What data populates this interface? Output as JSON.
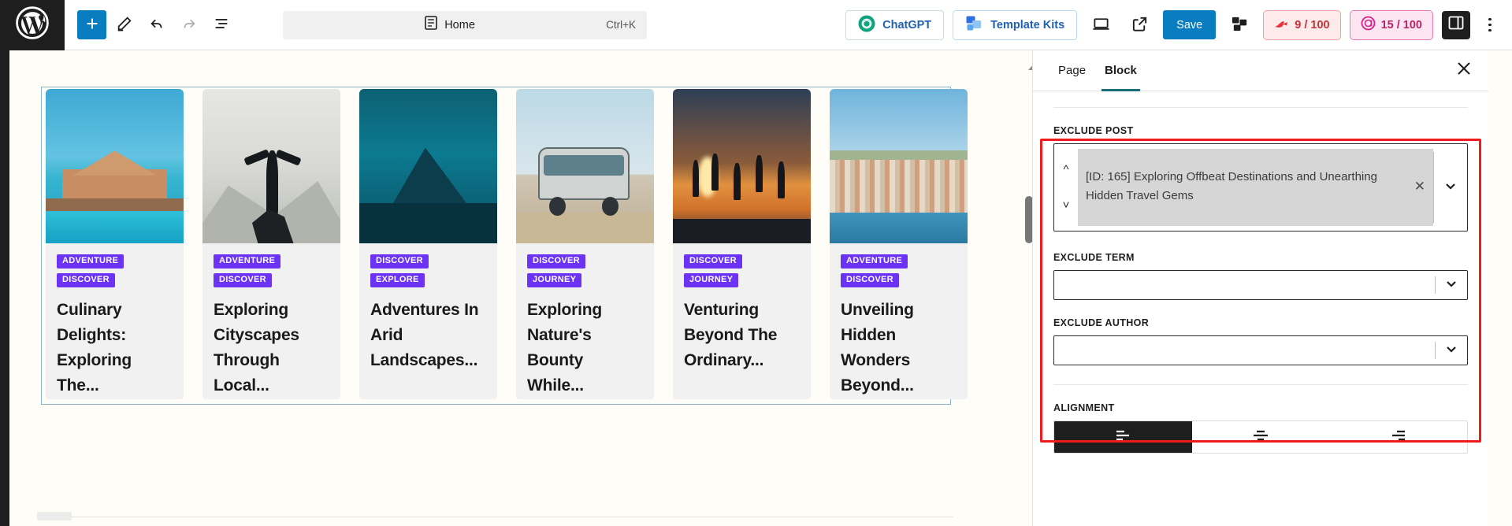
{
  "toolbar": {
    "logo_icon": "wordpress-logo-icon",
    "add_block_label": "+",
    "add_block_icon": "plus-icon",
    "edit_icon": "pencil-icon",
    "undo_icon": "undo-arrow-icon",
    "redo_icon": "redo-arrow-icon",
    "list_view_icon": "document-outline-icon",
    "command_bar": {
      "doc_icon": "page-icon",
      "label": "Home",
      "shortcut": "Ctrl+K"
    },
    "chatgpt_label": "ChatGPT",
    "chatgpt_icon": "chatgpt-logo-icon",
    "template_kits_label": "Template Kits",
    "template_kits_icon": "template-kits-icon",
    "preview_icon": "desktop-preview-icon",
    "view_site_icon": "external-link-icon",
    "save_label": "Save",
    "plugin_icon": "blocks-stack-icon",
    "seo_score": {
      "icon": "rank-math-icon",
      "value": "9 / 100"
    },
    "ai_score": {
      "icon": "ai-target-icon",
      "value": "15 / 100"
    },
    "settings_sidebar_icon": "sidebar-panel-icon",
    "options_icon": "kebab-menu-icon"
  },
  "canvas": {
    "posts": [
      {
        "image": "overwater-bungalow-photo",
        "tags": [
          "ADVENTURE",
          "DISCOVER"
        ],
        "title": "Culinary Delights: Exploring The..."
      },
      {
        "image": "woman-on-mountain-photo",
        "tags": [
          "ADVENTURE",
          "DISCOVER"
        ],
        "title": "Exploring Cityscapes Through Local..."
      },
      {
        "image": "arid-mountain-lake-photo",
        "tags": [
          "DISCOVER",
          "EXPLORE"
        ],
        "title": "Adventures In Arid Landscapes..."
      },
      {
        "image": "vintage-van-beach-photo",
        "tags": [
          "DISCOVER",
          "JOURNEY"
        ],
        "title": "Exploring Nature's Bounty While..."
      },
      {
        "image": "sunset-jumping-friends-photo",
        "tags": [
          "DISCOVER",
          "JOURNEY"
        ],
        "title": "Venturing Beyond The Ordinary..."
      },
      {
        "image": "coastal-town-harbor-photo",
        "tags": [
          "ADVENTURE",
          "DISCOVER"
        ],
        "title": "Unveiling Hidden Wonders Beyond..."
      }
    ],
    "tag_color": "#6d33f5"
  },
  "sidebar": {
    "tabs": [
      {
        "label": "Page",
        "active": false
      },
      {
        "label": "Block",
        "active": true
      }
    ],
    "close_icon": "close-x-icon",
    "scroll_up_icon": "caret-up-icon",
    "highlight_color": "#f11b1b",
    "fields": {
      "exclude_post": {
        "label": "EXCLUDE POST",
        "selected_value": "[ID: 165] Exploring Offbeat Destinations and Unearthing Hidden Travel Gems",
        "remove_icon": "chip-remove-x-icon",
        "spin_up_icon": "chevron-up-icon",
        "spin_down_icon": "chevron-down-icon",
        "dropdown_icon": "chevron-down-icon"
      },
      "exclude_term": {
        "label": "EXCLUDE TERM",
        "value": "",
        "dropdown_icon": "chevron-down-icon"
      },
      "exclude_author": {
        "label": "EXCLUDE AUTHOR",
        "value": "",
        "dropdown_icon": "chevron-down-icon"
      },
      "alignment": {
        "label": "ALIGNMENT",
        "options": [
          {
            "name": "align-left",
            "active": true
          },
          {
            "name": "align-center",
            "active": false
          },
          {
            "name": "align-right",
            "active": false
          }
        ]
      }
    }
  }
}
